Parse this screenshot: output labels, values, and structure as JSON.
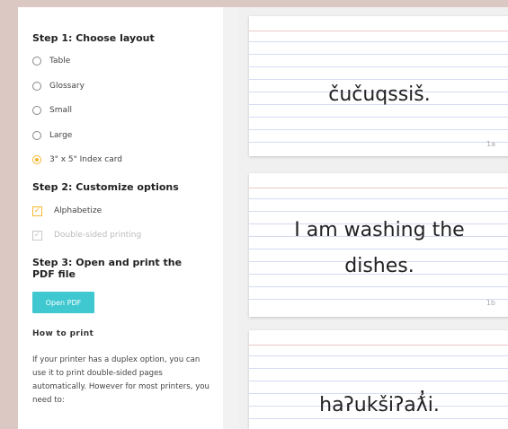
{
  "step1": {
    "title": "Step 1: Choose layout",
    "options": [
      {
        "label": "Table",
        "selected": false
      },
      {
        "label": "Glossary",
        "selected": false
      },
      {
        "label": "Small",
        "selected": false
      },
      {
        "label": "Large",
        "selected": false
      },
      {
        "label": "3\" x 5\" Index card",
        "selected": true
      }
    ]
  },
  "step2": {
    "title": "Step 2: Customize options",
    "options": [
      {
        "label": "Alphabetize",
        "checked": true,
        "enabled": true
      },
      {
        "label": "Double-sided printing",
        "checked": true,
        "enabled": false
      }
    ]
  },
  "step3": {
    "title": "Step 3: Open and print the PDF file",
    "button_label": "Open PDF"
  },
  "howto": {
    "title": "How to print",
    "text": "If your printer has a duplex option, you can use it to print double-sided pages automatically. However for most printers, you need to:"
  },
  "cards": [
    {
      "text": "čučuqssiš.",
      "number": "1a"
    },
    {
      "text": "I am washing the dishes.",
      "number": "1b"
    },
    {
      "text": "haʔukšiʔaƛ̓i.",
      "number": ""
    }
  ],
  "colors": {
    "accent": "#f5b82e",
    "button": "#3fc8d0"
  }
}
